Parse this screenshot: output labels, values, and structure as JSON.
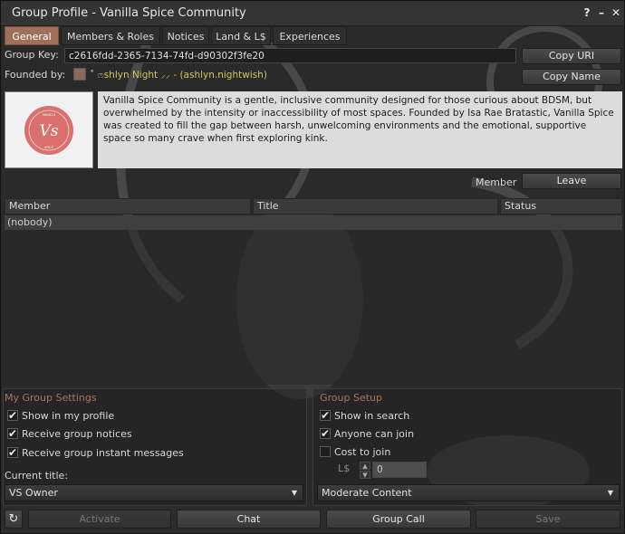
{
  "window": {
    "title": "Group Profile - Vanilla Spice Community",
    "help_glyph": "?",
    "minimize_glyph": "–",
    "close_glyph": "✕"
  },
  "tabs": [
    {
      "label": "General",
      "active": true
    },
    {
      "label": "Members & Roles",
      "active": false
    },
    {
      "label": "Notices",
      "active": false
    },
    {
      "label": "Land & L$",
      "active": false
    },
    {
      "label": "Experiences",
      "active": false
    }
  ],
  "group_key": {
    "label": "Group Key:",
    "value": "c2616fdd-2365-7134-74fd-d90302f3fe20",
    "copy_uri": "Copy URI"
  },
  "founded_by": {
    "label": "Founded by:",
    "name": "˚ ෆshlyn Night ⸝⸝ - (ashlyn.nightwish)",
    "copy_name": "Copy Name",
    "name_color": "#d6c35a"
  },
  "insignia": {
    "monogram": "Vs",
    "ring_text_top": "VANILLA",
    "ring_text_bottom": "SPICE",
    "color": "#d9706e"
  },
  "charter": "Vanilla Spice Community is a gentle, inclusive community designed for those curious about BDSM, but overwhelmed by the intensity or inaccessibility of most spaces. Founded by Isa Rae Bratastic, Vanilla Spice was created to fill the gap between harsh, unwelcoming environments and the emotional, supportive space so many crave when first exploring kink.",
  "membership": {
    "label": "Member",
    "leave": "Leave"
  },
  "members_list": {
    "columns": [
      "Member",
      "Title",
      "Status"
    ],
    "empty_text": "(nobody)"
  },
  "my_group_settings": {
    "title": "My Group Settings",
    "checkboxes": [
      {
        "label": "Show in my profile",
        "checked": true
      },
      {
        "label": "Receive group notices",
        "checked": true
      },
      {
        "label": "Receive group instant messages",
        "checked": true
      }
    ],
    "current_title_label": "Current title:",
    "current_title_value": "VS Owner"
  },
  "group_setup": {
    "title": "Group Setup",
    "checkboxes": [
      {
        "label": "Show in search",
        "checked": true
      },
      {
        "label": "Anyone can join",
        "checked": true
      },
      {
        "label": "Cost to join",
        "checked": false
      }
    ],
    "currency_label": "L$",
    "cost_value": "0",
    "maturity_value": "Moderate Content"
  },
  "bottom_bar": {
    "refresh_glyph": "↻",
    "activate": "Activate",
    "chat": "Chat",
    "group_call": "Group Call",
    "save": "Save"
  },
  "check_glyph": "✔"
}
